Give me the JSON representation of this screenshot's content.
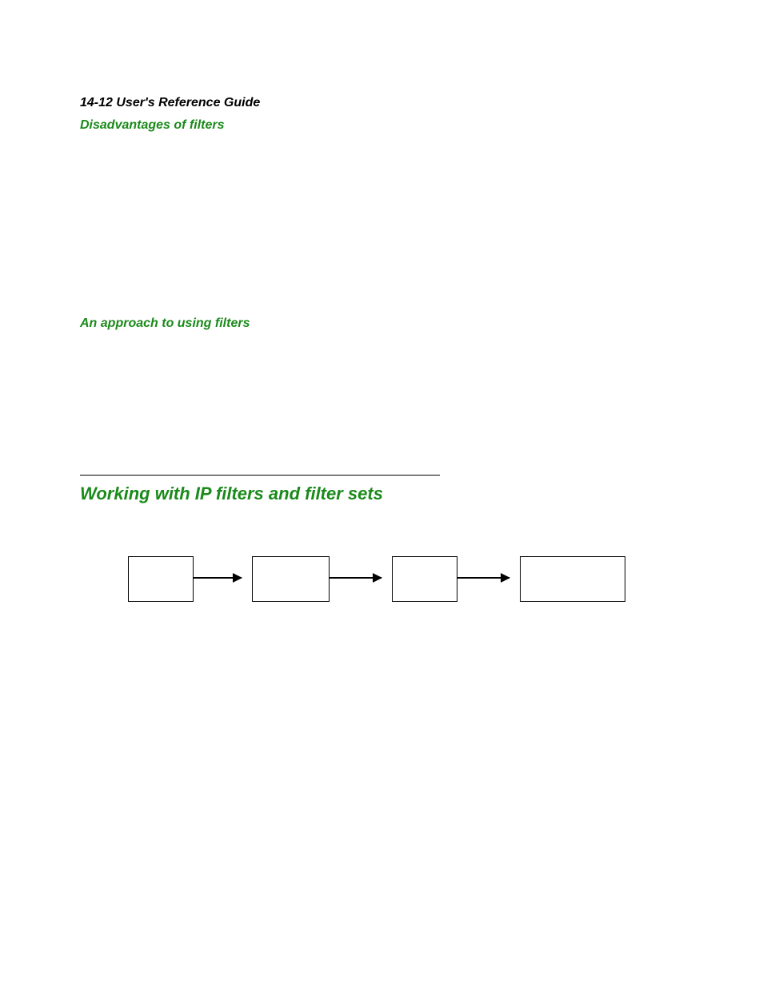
{
  "header": {
    "page_label": "14-12  User's Reference Guide"
  },
  "subheadings": {
    "disadvantages": "Disadvantages of filters",
    "approach": "An approach to using filters"
  },
  "section": {
    "title": "Working with IP filters and filter sets"
  },
  "colors": {
    "accent_green": "#1a8a1a"
  }
}
